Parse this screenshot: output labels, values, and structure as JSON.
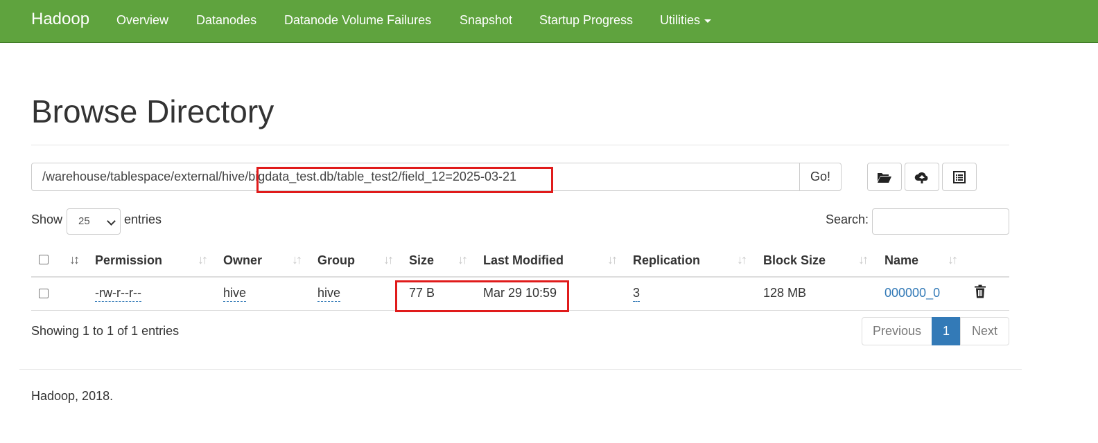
{
  "navbar": {
    "brand": "Hadoop",
    "items": [
      "Overview",
      "Datanodes",
      "Datanode Volume Failures",
      "Snapshot",
      "Startup Progress",
      "Utilities"
    ],
    "background": "#5fa33e"
  },
  "page": {
    "title": "Browse Directory",
    "path_prefix": "/warehouse/tablespace/external/hive",
    "path_suffix": "/bigdata_test.db/table_test2/field_12=2025-03-21",
    "go_label": "Go!",
    "icons": [
      "folder-open-icon",
      "cloud-upload-icon",
      "list-icon"
    ]
  },
  "entries": {
    "show_label": "Show",
    "selected": "25",
    "entries_label": "entries",
    "search_label": "Search:",
    "search_value": ""
  },
  "table": {
    "headers": [
      "Permission",
      "Owner",
      "Group",
      "Size",
      "Last Modified",
      "Replication",
      "Block Size",
      "Name"
    ],
    "rows": [
      {
        "permission": "-rw-r--r--",
        "owner": "hive",
        "group": "hive",
        "size": "77 B",
        "last_modified": "Mar 29 10:59",
        "replication": "3",
        "block_size": "128 MB",
        "name": "000000_0"
      }
    ]
  },
  "summary": {
    "showing": "Showing 1 to 1 of 1 entries"
  },
  "pagination": {
    "previous": "Previous",
    "current": "1",
    "next": "Next"
  },
  "footer": {
    "text": "Hadoop, 2018."
  },
  "annotations": {
    "highlight_color": "#e01b1b"
  }
}
